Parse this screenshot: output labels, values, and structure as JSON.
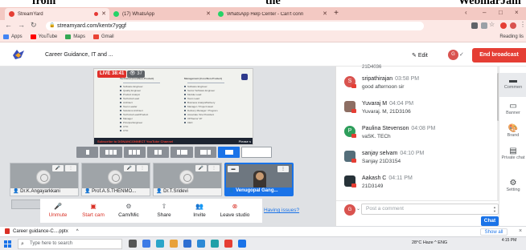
{
  "caption": {
    "left": "from",
    "mid": "the",
    "right": "WebinarJam"
  },
  "browser": {
    "tabs": [
      {
        "label": "StreamYard",
        "active": true,
        "favicon_color": "#e53e34",
        "recording": true
      },
      {
        "label": "(17) WhatsApp",
        "active": false,
        "favicon_color": "#25d366",
        "recording": false
      },
      {
        "label": "WhatsApp Help Center - Can't conn",
        "active": false,
        "favicon_color": "#25d366",
        "recording": false
      }
    ],
    "new_tab": "+",
    "window_controls": [
      "‹",
      "–",
      "□",
      "×"
    ],
    "url": "streamyard.com/kentx7yggf",
    "bookmarks": [
      {
        "label": "Apps",
        "color": "#4285f4"
      },
      {
        "label": "YouTube",
        "color": "#ff0000"
      },
      {
        "label": "Maps",
        "color": "#34a853"
      },
      {
        "label": "Gmail",
        "color": "#ea4335"
      }
    ],
    "reading_list": "Reading lis"
  },
  "header": {
    "title": "Career Guidance, IT and ...",
    "edit": "Edit",
    "avatar_initial": "G",
    "end_broadcast": "End broadcast"
  },
  "stage": {
    "live_badge": "LIVE 38:41",
    "viewers": "37",
    "slide_left_heading": "Technical (Core/Non-Product)",
    "slide_right_heading": "Management (Core/Non-Product)",
    "slide_left_items": [
      "Software Engineer",
      "Quality Engineer",
      "Product Analyst",
      "Technical Lead",
      "Architect",
      "Team Leader",
      "Solutions Architect",
      "Technical Lead/Product",
      "Manager",
      "Principal Engineer",
      "CTO",
      "CTO"
    ],
    "slide_right_items": [
      "Software Engineer",
      "Senior Software Engineer",
      "Module Lead",
      "Team Lead",
      "Business Analyst/Delivery",
      "Manager / Project Head",
      "Delivery Manager / Program",
      "Associate Vice President",
      "VP/Senior VP",
      "CEO"
    ],
    "banner_lead": "Subscribe to DGNANCONNECT YouTube Channel",
    "banner_tail": "Please s"
  },
  "guests": [
    {
      "name": "Dr.K.Angayarkkani",
      "live": false
    },
    {
      "name": "Prof.A.S.THENMO...",
      "live": false
    },
    {
      "name": "Dr.T.Sridevi",
      "live": false
    },
    {
      "name": "Venugopal Gang...",
      "live": true
    }
  ],
  "controls": [
    {
      "label": "Unmute",
      "icon": "🎤",
      "danger": true
    },
    {
      "label": "Start cam",
      "icon": "▣",
      "danger": true
    },
    {
      "label": "Cam/Mic",
      "icon": "⚙",
      "danger": false
    },
    {
      "label": "Share",
      "icon": "⇧",
      "danger": false
    },
    {
      "label": "Invite",
      "icon": "👥",
      "danger": false
    },
    {
      "label": "Leave studio",
      "icon": "⊗",
      "danger": true
    }
  ],
  "having_issues": "Having issues?",
  "chat": {
    "top_fragment": "21D4036",
    "messages": [
      {
        "author": "sripathirajan",
        "time": "03:58 PM",
        "body": "good afternoon sir",
        "initial": "S",
        "color": "#d9534f",
        "photo": false
      },
      {
        "author": "Yuvaraj M",
        "time": "04:04 PM",
        "body": "Yuvaraj. M, 21D3106",
        "initial": "",
        "color": "#8d6e63",
        "photo": true
      },
      {
        "author": "Paulina Stevenson",
        "time": "04:08 PM",
        "body": "vaSK. TECh",
        "initial": "P",
        "color": "#2e9e5b",
        "photo": false
      },
      {
        "author": "sanjay selvam",
        "time": "04:10 PM",
        "body": "Sanjay 21D3154",
        "initial": "",
        "color": "#546e7a",
        "photo": true
      },
      {
        "author": "Aakash C",
        "time": "04:11 PM",
        "body": "21D3149",
        "initial": "",
        "color": "#263238",
        "photo": true
      }
    ],
    "composer_placeholder": "Post a comment",
    "composer_avatar": "G",
    "send_label": "Chat"
  },
  "rail": [
    {
      "label": "Commen",
      "icon": "▬",
      "selected": true
    },
    {
      "label": "Banner",
      "icon": "▭",
      "selected": false
    },
    {
      "label": "Brand",
      "icon": "🎨",
      "selected": false
    },
    {
      "label": "Private chat",
      "icon": "▤",
      "selected": false
    },
    {
      "label": "Setting",
      "icon": "⚙",
      "selected": false
    }
  ],
  "download": {
    "file": "Career guidance-C....pptx",
    "show_all": "Show all",
    "close": "×"
  },
  "taskbar": {
    "search_placeholder": "Type here to search",
    "tray": "28°C Haze  ^  ENG",
    "time": "4:15 PM",
    "app_colors": [
      "#555",
      "#3d7be6",
      "#2aa5c9",
      "#e8a13a",
      "#2f6fd1",
      "#2c8ad6",
      "#21a0a8",
      "#e53e34",
      "#1a73e8"
    ]
  },
  "colors": {
    "accent": "#1a73e8",
    "danger": "#e53e34",
    "tabbar": "#f3c9c3"
  }
}
